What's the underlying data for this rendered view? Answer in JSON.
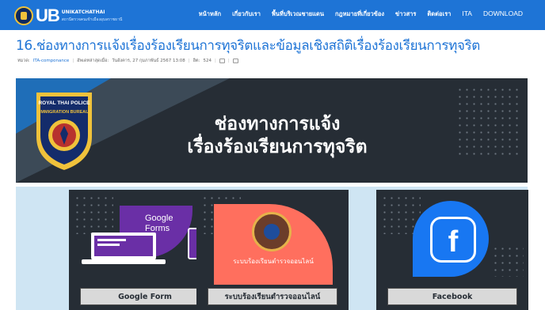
{
  "header": {
    "logo_letters": "UB",
    "logo_line1": "UNIKATCHATHAI",
    "logo_line2": "สถานีตรวจคนเข้าเมืองอุบลราชธานี",
    "nav": [
      "หน้าหลัก",
      "เกี่ยวกับเรา",
      "พื้นที่บริเวณชายแดน",
      "กฎหมายที่เกี่ยวข้อง",
      "ข่าวสาร",
      "ติดต่อเรา",
      "ITA",
      "DOWNLOAD"
    ]
  },
  "article": {
    "title": "16.ช่องทางการแจ้งเรื่องร้องเรียนการทุจริตและข้อมูลเชิงสถิติเรื่องร้องเรียนการทุจริต",
    "category_label": "หมวด:",
    "category": "ITA-componance",
    "updated_label": "อัพเดทล่าสุดเมื่อ:",
    "updated": "วันอังคาร, 27 กุมภาพันธ์ 2567 13:08",
    "hits_label": "ฮิต:",
    "hits": "524"
  },
  "banner": {
    "line1": "ช่องทางการแจ้ง",
    "line2": "เรื่องร้องเรียนการทุจริต",
    "badge_top": "ROYAL THAI POLICE",
    "badge_mid": "IMMIGRATION BUREAU"
  },
  "cards": [
    {
      "label": "Google Form",
      "art_text": "Google\nForms",
      "icon": "google-forms-icon"
    },
    {
      "label": "ระบบร้องเรียนตำรวจออนไลน์",
      "art_text": "ระบบร้องเรียนตำรวจออนไลน์",
      "icon": "police-seal-icon"
    },
    {
      "label": "Facebook",
      "art_text": "f",
      "icon": "facebook-icon"
    }
  ],
  "colors": {
    "header_bg": "#1e74d6",
    "title": "#1e74d6",
    "banner_bg": "#262d35",
    "cards_bg": "#cfe5f3",
    "google_forms": "#6a2fa6",
    "police_red": "#ff6f5e",
    "facebook": "#1877f2"
  }
}
